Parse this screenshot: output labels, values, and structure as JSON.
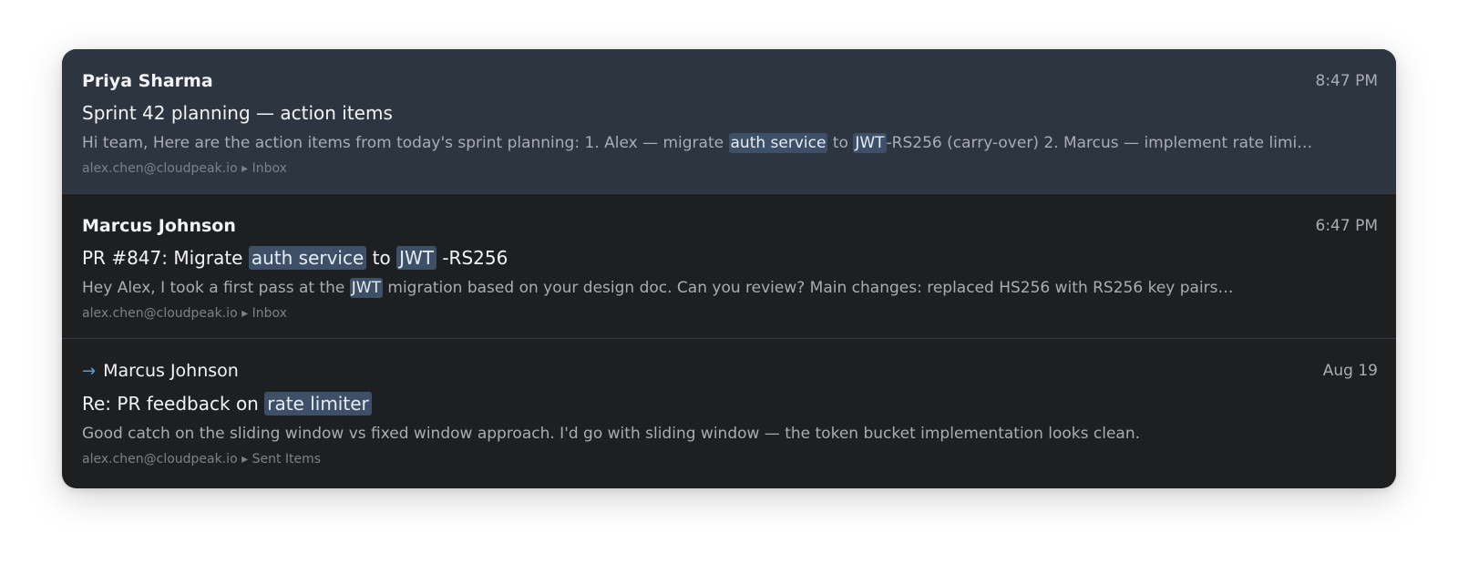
{
  "emails": [
    {
      "sender": "Priya Sharma",
      "time": "8:47 PM",
      "subject_parts": [
        "Sprint 42 planning — action items"
      ],
      "preview_parts": [
        "Hi team, Here are the action items from today's sprint planning: 1. Alex — migrate ",
        "auth service",
        " to ",
        "JWT",
        "-RS256 (carry-over) 2. Marcus — implement rate limi…"
      ],
      "account": "alex.chen@cloudpeak.io",
      "separator": "▸",
      "folder": "Inbox"
    },
    {
      "sender": "Marcus Johnson",
      "time": "6:47 PM",
      "subject_parts": [
        "PR #847: Migrate ",
        "auth service",
        " to ",
        "JWT",
        " -RS256"
      ],
      "preview_parts": [
        "Hey Alex, I took a first pass at the ",
        "JWT",
        " migration based on your design doc. Can you review? Main changes: replaced HS256 with RS256 key pairs…"
      ],
      "account": "alex.chen@cloudpeak.io",
      "separator": "▸",
      "folder": "Inbox"
    },
    {
      "sent_arrow": "→",
      "sender": "Marcus Johnson",
      "time": "Aug 19",
      "subject_parts": [
        "Re: PR feedback on ",
        "rate limiter"
      ],
      "preview_parts": [
        "Good catch on the sliding window vs fixed window approach. I'd go with sliding window — the token bucket implementation looks clean."
      ],
      "account": "alex.chen@cloudpeak.io",
      "separator": "▸",
      "folder": "Sent Items"
    }
  ],
  "colors": {
    "panel_bg": "#1e1f21",
    "selected_bg": "#2d3540",
    "highlight_bg": "#3e5068",
    "sent_arrow": "#5b9bd5"
  }
}
